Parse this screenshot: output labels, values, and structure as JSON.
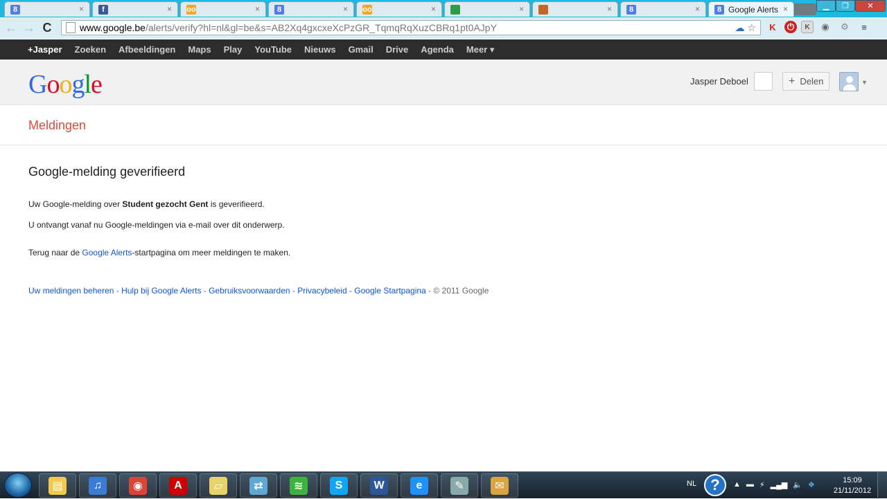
{
  "browser": {
    "tabs": [
      {
        "title": "",
        "favicon": "8",
        "favicon_color": "#4f7ee8"
      },
      {
        "title": "",
        "favicon": "f",
        "favicon_color": "#3b5998"
      },
      {
        "title": "",
        "favicon": "oo",
        "favicon_color": "#f3a623"
      },
      {
        "title": "",
        "favicon": "8",
        "favicon_color": "#4f7ee8"
      },
      {
        "title": "",
        "favicon": "oo",
        "favicon_color": "#f3a623"
      },
      {
        "title": "",
        "favicon": "drive",
        "favicon_color": "#2e9b47"
      },
      {
        "title": "",
        "favicon": "avatar",
        "favicon_color": "#c0692b"
      },
      {
        "title": "",
        "favicon": "8",
        "favicon_color": "#4f7ee8"
      },
      {
        "title": "Google Alerts",
        "favicon": "8",
        "favicon_color": "#4f7ee8",
        "active": true
      }
    ],
    "url_host": "www.google.be",
    "url_path": "/alerts/verify?hl=nl&gl=be&s=AB2Xq4gxcxeXcPzGR_TqmqRqXuzCBRq1pt0AJpY"
  },
  "gbar": {
    "items": [
      "+Jasper",
      "Zoeken",
      "Afbeeldingen",
      "Maps",
      "Play",
      "YouTube",
      "Nieuws",
      "Gmail",
      "Drive",
      "Agenda",
      "Meer ▾"
    ]
  },
  "header": {
    "logo_letters": [
      {
        "ch": "G",
        "color": "#3369e8"
      },
      {
        "ch": "o",
        "color": "#d50f25"
      },
      {
        "ch": "o",
        "color": "#eeb211"
      },
      {
        "ch": "g",
        "color": "#3369e8"
      },
      {
        "ch": "l",
        "color": "#009925"
      },
      {
        "ch": "e",
        "color": "#d50f25"
      }
    ],
    "user_name": "Jasper Deboel",
    "share_label": "Delen"
  },
  "section": {
    "title": "Meldingen"
  },
  "content": {
    "heading": "Google-melding geverifieerd",
    "line1_pre": "Uw Google-melding over ",
    "line1_bold": "Student gezocht Gent",
    "line1_post": " is geverifieerd.",
    "line2": "U ontvangt vanaf nu Google-meldingen via e-mail over dit onderwerp.",
    "line3_pre": "Terug naar de ",
    "line3_link": "Google Alerts",
    "line3_post": "-startpagina om meer meldingen te maken."
  },
  "footer": {
    "links": [
      "Uw meldingen beheren",
      "Hulp bij Google Alerts",
      "Gebruiksvoorwaarden",
      "Privacybeleid",
      "Google Startpagina"
    ],
    "separator": " - ",
    "copyright": "© 2011 Google"
  },
  "taskbar": {
    "apps": [
      {
        "name": "explorer",
        "glyph": "▤",
        "color": "#f2c94c"
      },
      {
        "name": "itunes",
        "glyph": "♫",
        "color": "#3a7bd5"
      },
      {
        "name": "chrome",
        "glyph": "◉",
        "color": "#db4437"
      },
      {
        "name": "acrobat",
        "glyph": "A",
        "color": "#c00"
      },
      {
        "name": "notes",
        "glyph": "▱",
        "color": "#e8d36a"
      },
      {
        "name": "network",
        "glyph": "⇄",
        "color": "#5fa8d3"
      },
      {
        "name": "spotify",
        "glyph": "≋",
        "color": "#3db33d"
      },
      {
        "name": "skype",
        "glyph": "S",
        "color": "#12a5f4"
      },
      {
        "name": "word",
        "glyph": "W",
        "color": "#2b579a"
      },
      {
        "name": "internet-explorer",
        "glyph": "e",
        "color": "#1e90ff"
      },
      {
        "name": "paint",
        "glyph": "✎",
        "color": "#8aa"
      },
      {
        "name": "outlook",
        "glyph": "✉",
        "color": "#d9a441"
      }
    ],
    "language": "NL",
    "time": "15:09",
    "date": "21/11/2012"
  }
}
